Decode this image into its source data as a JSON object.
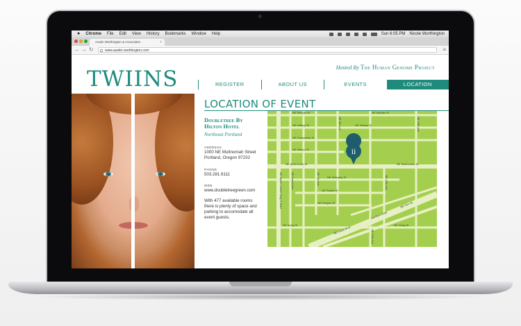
{
  "menubar": {
    "apple": "",
    "items": [
      "Chrome",
      "File",
      "Edit",
      "View",
      "History",
      "Bookmarks",
      "Window",
      "Help"
    ],
    "clock": "Sun 6:05 PM",
    "user": "Nicole Worthington"
  },
  "browser": {
    "tab_title": "Austin Worthington & Associates",
    "tab_close": "×",
    "url": "www.austin-worthington.com",
    "back_label": "←",
    "forward_label": "→",
    "reload_label": "↻",
    "menu_label": "≡"
  },
  "site": {
    "logo": "TWIINS",
    "hosted_by_prefix": "Hosted By",
    "hosted_by_org": "The Human Genome Project",
    "nav": [
      {
        "label": "REGISTER",
        "active": false
      },
      {
        "label": "ABOUT US",
        "active": false
      },
      {
        "label": "EVENTS",
        "active": false
      },
      {
        "label": "LOCATION",
        "active": true
      }
    ]
  },
  "location": {
    "title": "LOCATION OF EVENT",
    "venue_name": "Doubletree By Hilton Hotel",
    "venue_area": "Northeast Portland",
    "address_label": "ADDRESS",
    "address_line1": "1000 NE Multnomah Street",
    "address_line2": "Portland, Oregon 97232",
    "phone_label": "PHONE",
    "phone": "503.281.6111",
    "web_label": "WEB",
    "web": "www.doubletreegreen.com",
    "description": "With 477 available rooms there is plenty of space and parking to accomodate all event guests."
  },
  "map": {
    "colors": {
      "land": "#a4cf4e",
      "roads": "#e7f0c4",
      "pin": "#1e5d6b"
    },
    "streets": [
      "NE Weidler St",
      "NE Halsey St",
      "NE Clackamas St",
      "NE Wasco St",
      "NE Multnomah St",
      "NE Holladay St",
      "NE Pacific St",
      "NE Oregon St",
      "NE Irving St",
      "NE Lloyd Blvd",
      "NE 7th Ave",
      "NE 9th Ave",
      "NE 11th Ave",
      "NE 13th Ave",
      "NE 15th Ave",
      "NE Grand Ave",
      "NE Martin Luther King Jr Blvd",
      "NE Union Ave",
      "Banfield Expy",
      "NE Sun Dr"
    ]
  },
  "brand_colors": {
    "accent": "#1e8b7c"
  }
}
